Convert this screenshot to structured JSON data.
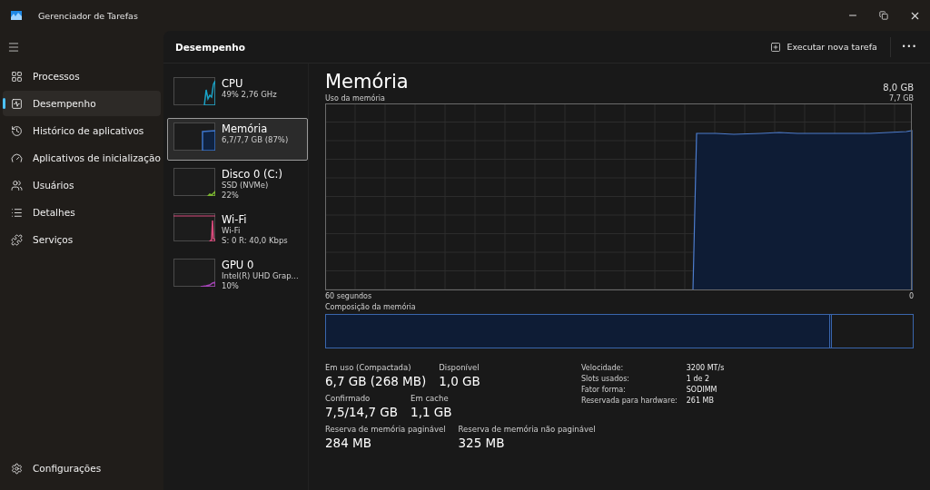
{
  "window": {
    "title": "Gerenciador de Tarefas"
  },
  "nav": [
    {
      "label": "Processos",
      "selected": false
    },
    {
      "label": "Desempenho",
      "selected": true
    },
    {
      "label": "Histórico de aplicativos",
      "selected": false
    },
    {
      "label": "Aplicativos de inicialização",
      "selected": false
    },
    {
      "label": "Usuários",
      "selected": false
    },
    {
      "label": "Detalhes",
      "selected": false
    },
    {
      "label": "Serviços",
      "selected": false
    }
  ],
  "settings": {
    "label": "Configurações"
  },
  "header": {
    "title": "Desempenho",
    "run_task": "Executar nova tarefa",
    "more": "•••"
  },
  "devices": [
    {
      "kind": "cpu",
      "name": "CPU",
      "lines": [
        "49%  2,76 GHz"
      ],
      "color": "#1aa3c7",
      "selected": false
    },
    {
      "kind": "memory",
      "name": "Memória",
      "lines": [
        "6,7/7,7 GB (87%)"
      ],
      "color": "#3d74c9",
      "selected": true
    },
    {
      "kind": "disk",
      "name": "Disco 0 (C:)",
      "lines": [
        "SSD (NVMe)",
        "22%"
      ],
      "color": "#7cb82f",
      "selected": false
    },
    {
      "kind": "wifi",
      "name": "Wi-Fi",
      "lines": [
        "Wi-Fi",
        "S: 0 R: 40,0 Kbps"
      ],
      "color": "#d94b7c",
      "selected": false
    },
    {
      "kind": "gpu",
      "name": "GPU 0",
      "lines": [
        "Intel(R) UHD Grap...",
        "10%"
      ],
      "color": "#a343b5",
      "selected": false
    }
  ],
  "detail": {
    "title": "Memória",
    "total": "8,0 GB",
    "graph_label": "Uso da memória",
    "graph_max": "7,7 GB",
    "x_start": "60 segundos",
    "x_end": "0",
    "composition_label": "Composição da memória",
    "composition": {
      "level": 0.862
    },
    "stats": [
      [
        {
          "label": "Em uso (Compactada)",
          "value": "6,7 GB (268 MB)"
        },
        {
          "label": "Disponível",
          "value": "1,0 GB"
        }
      ],
      [
        {
          "label": "Confirmado",
          "value": "7,5/14,7 GB"
        },
        {
          "label": "Em cache",
          "value": "1,1 GB"
        }
      ],
      [
        {
          "label": "Reserva de memória paginável",
          "value": "284 MB"
        },
        {
          "label": "Reserva de memória não paginável",
          "value": "325 MB"
        }
      ]
    ],
    "properties": [
      {
        "key": "Velocidade:",
        "value": "3200 MT/s"
      },
      {
        "key": "Slots usados:",
        "value": "1 de 2"
      },
      {
        "key": "Fator forma:",
        "value": "SODIMM"
      },
      {
        "key": "Reservada para hardware:",
        "value": "261 MB"
      }
    ]
  }
}
